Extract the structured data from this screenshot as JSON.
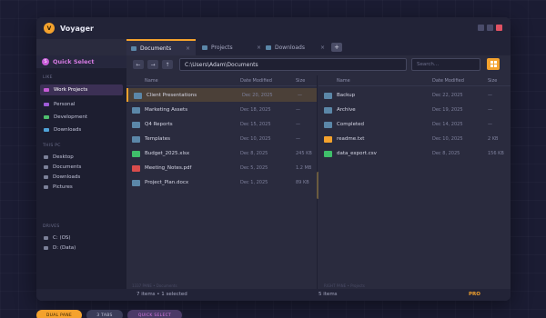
{
  "app": {
    "logo_letter": "V",
    "name": "Voyager"
  },
  "tabs": [
    {
      "label": "Documents",
      "close": "×"
    },
    {
      "label": "Projects",
      "close": "×"
    },
    {
      "label": "Downloads",
      "close": "×"
    }
  ],
  "tab_add": "+",
  "toolbar": {
    "back": "←",
    "forward": "→",
    "up": "↑",
    "path": "C:\\Users\\Adam\\Documents",
    "search_placeholder": "Search..."
  },
  "sidebar": {
    "quick_select": {
      "icon": "S",
      "label": "Quick Select"
    },
    "sections": {
      "favorites": "LIKE",
      "this_pc": "THIS PC",
      "drives": "DRIVES"
    },
    "favorites": [
      {
        "label": "Work Projects",
        "color": "#c65bd6"
      },
      {
        "label": "Personal",
        "color": "#9d5bd6"
      },
      {
        "label": "Development",
        "color": "#4fbf6e"
      },
      {
        "label": "Downloads",
        "color": "#4fa3d8"
      }
    ],
    "this_pc": [
      "Desktop",
      "Documents",
      "Downloads",
      "Pictures"
    ],
    "drives": [
      "C: (OS)",
      "D: (Data)"
    ]
  },
  "columns": {
    "name": "Name",
    "date": "Date Modified",
    "size": "Size"
  },
  "left_pane": {
    "files": [
      {
        "name": "Client Presentations",
        "date": "Dec 20, 2025",
        "size": "—",
        "kind": "folder",
        "color": "#5b87a8"
      },
      {
        "name": "Marketing Assets",
        "date": "Dec 18, 2025",
        "size": "—",
        "kind": "folder",
        "color": "#5b87a8"
      },
      {
        "name": "Q4 Reports",
        "date": "Dec 15, 2025",
        "size": "—",
        "kind": "folder",
        "color": "#5b87a8"
      },
      {
        "name": "Templates",
        "date": "Dec 10, 2025",
        "size": "—",
        "kind": "folder",
        "color": "#5b87a8"
      },
      {
        "name": "Budget_2025.xlsx",
        "date": "Dec 8, 2025",
        "size": "245 KB",
        "kind": "xlsx",
        "color": "#3fbf6a"
      },
      {
        "name": "Meeting_Notes.pdf",
        "date": "Dec 5, 2025",
        "size": "1.2 MB",
        "kind": "pdf",
        "color": "#d94c4c"
      },
      {
        "name": "Project_Plan.docx",
        "date": "Dec 1, 2025",
        "size": "89 KB",
        "kind": "docx",
        "color": "#5b87a8"
      }
    ],
    "footer": "1337 PANE • Documents"
  },
  "right_pane": {
    "files": [
      {
        "name": "Backup",
        "date": "Dec 22, 2025",
        "size": "—",
        "kind": "folder",
        "color": "#5b87a8"
      },
      {
        "name": "Archive",
        "date": "Dec 19, 2025",
        "size": "—",
        "kind": "folder",
        "color": "#5b87a8"
      },
      {
        "name": "Completed",
        "date": "Dec 14, 2025",
        "size": "—",
        "kind": "folder",
        "color": "#5b87a8"
      },
      {
        "name": "readme.txt",
        "date": "Dec 10, 2025",
        "size": "2 KB",
        "kind": "txt",
        "color": "#f4a22d"
      },
      {
        "name": "data_export.csv",
        "date": "Dec 8, 2025",
        "size": "156 KB",
        "kind": "csv",
        "color": "#3fbf6a"
      }
    ],
    "footer": "RIGHT PANE • Projects"
  },
  "status": {
    "left": "7 items • 1 selected",
    "right": "5 items",
    "badge": "PRO"
  },
  "chips": [
    {
      "label": "DUAL PANE",
      "bg": "#f4a22d",
      "fg": "#2a1a00"
    },
    {
      "label": "3 TABS",
      "bg": "#3a3c58",
      "fg": "#c3c5da"
    },
    {
      "label": "QUICK SELECT",
      "bg": "#4a3a66",
      "fg": "#d77be3"
    }
  ]
}
